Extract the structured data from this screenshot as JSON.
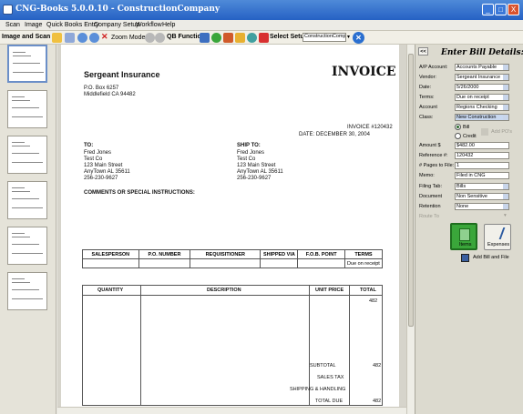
{
  "window": {
    "title": "CNG-Books 5.0.0.10 - ConstructionCompany",
    "minimize": "_",
    "maximize": "□",
    "close": "X"
  },
  "menu": [
    "Scan",
    "Image",
    "Quick Books Entry",
    "Company Setup",
    "Workflow",
    "Help"
  ],
  "toolbar": {
    "section_label": "Image and Scan",
    "zoom_label": "Zoom Mode ▾",
    "qb_label": "QB Functions",
    "select_setup": "Select Setup",
    "company_select": "ConstructionCompar"
  },
  "invoice": {
    "company": "Sergeant Insurance",
    "address1": "P.O. Box 6257",
    "address2": "Middlefield CA 94482",
    "title": "INVOICE",
    "number": "INVOICE #120432",
    "date": "DATE: DECEMBER 30, 2004",
    "to_label": "TO:",
    "ship_label": "SHIP TO:",
    "to_lines": [
      "Fred Jones",
      "Test Co",
      "123 Main Street",
      "AnyTown AL 35611",
      "256-230-9627"
    ],
    "ship_lines": [
      "Fred Jones",
      "Test Co",
      "123 Main Street",
      "AnyTown AL 35611",
      "256-230-9627"
    ],
    "comments": "COMMENTS OR SPECIAL INSTRUCTIONS:",
    "sales_headers": [
      "SALESPERSON",
      "P.O. NUMBER",
      "REQUISITIONER",
      "SHIPPED VIA",
      "F.O.B. POINT",
      "TERMS"
    ],
    "sales_values": [
      "",
      "",
      "",
      "",
      "",
      "Due on receipt"
    ],
    "item_headers": [
      "QUANTITY",
      "DESCRIPTION",
      "UNIT PRICE",
      "TOTAL"
    ],
    "item_total": "482",
    "subtotal_label": "SUBTOTAL",
    "subtotal_value": "482",
    "tax_label": "SALES TAX",
    "shipping_label": "SHIPPING & HANDLING",
    "total_due_label": "TOTAL DUE",
    "total_due_value": "482"
  },
  "bill": {
    "collapse": "<<",
    "heading": "Enter Bill Details:",
    "ap_account_label": "A/P Account:",
    "ap_account": "Accounts Payable",
    "vendor_label": "Vendor:",
    "vendor": "Sergeant Insurance",
    "date_label": "Date:",
    "date": "5/26/2000",
    "terms_label": "Terms:",
    "terms": "Due on receipt",
    "account_label": "Account",
    "account": "Regions Checking",
    "class_label": "Class:",
    "class": "New Construction",
    "bill_radio": "Bill",
    "credit_radio": "Credit",
    "add_pos": "Add PO's",
    "amount_label": "Amount $",
    "amount": "$482.00",
    "reference_label": "Reference #:",
    "reference": "120432",
    "pages_label": "# Pages to File:",
    "pages": "1",
    "memo_label": "Memo:",
    "memo": "Filed in CNG",
    "filing_tab_label": "Filing Tab:",
    "filing_tab": "Bills",
    "document_label": "Document",
    "document": "Non Sensitive",
    "retention_label": "Retention",
    "retention": "None",
    "route_label": "Route To",
    "items_button": "Items",
    "expenses_button": "Expenses",
    "add_bill_button": "Add Bill and File"
  },
  "colors": {
    "title_bar": "#2561c4",
    "class_highlight": "#c8d8f0",
    "items_button": "#3aa63a"
  }
}
